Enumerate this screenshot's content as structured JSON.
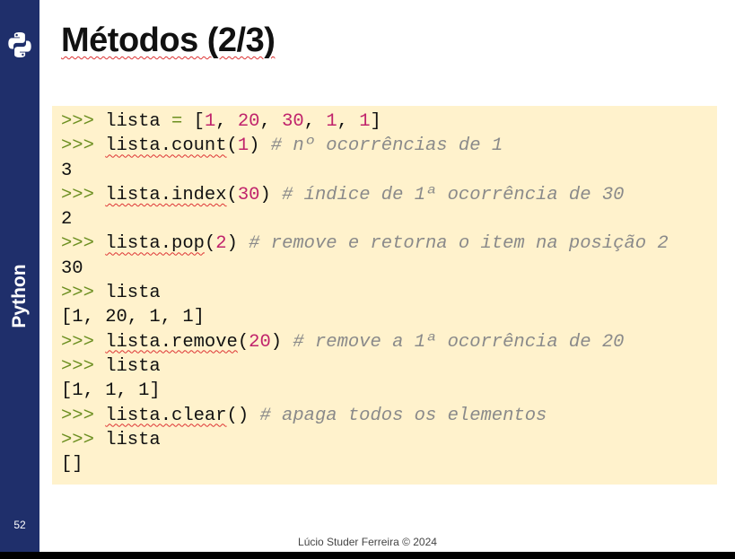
{
  "sidebar": {
    "label": "Python",
    "page_number": "52",
    "logo_icon": "python-logo-icon",
    "color": "#1f2f6b"
  },
  "slide": {
    "title": "Métodos (2/3)",
    "footer": "Lúcio Studer Ferreira © 2024"
  },
  "code": {
    "prompt": ">>>",
    "lines": [
      {
        "t": "in",
        "tokens": [
          {
            "k": "p",
            "v": ">>>"
          },
          {
            "k": "x",
            "v": " lista "
          },
          {
            "k": "e",
            "v": "="
          },
          {
            "k": "x",
            "v": " ["
          },
          {
            "k": "n",
            "v": "1"
          },
          {
            "k": "x",
            "v": ", "
          },
          {
            "k": "n",
            "v": "20"
          },
          {
            "k": "x",
            "v": ", "
          },
          {
            "k": "n",
            "v": "30"
          },
          {
            "k": "x",
            "v": ", "
          },
          {
            "k": "n",
            "v": "1"
          },
          {
            "k": "x",
            "v": ", "
          },
          {
            "k": "n",
            "v": "1"
          },
          {
            "k": "x",
            "v": "]"
          }
        ]
      },
      {
        "t": "in",
        "tokens": [
          {
            "k": "p",
            "v": ">>>"
          },
          {
            "k": "x",
            "v": " "
          },
          {
            "k": "w",
            "v": "lista.count"
          },
          {
            "k": "x",
            "v": "("
          },
          {
            "k": "n",
            "v": "1"
          },
          {
            "k": "x",
            "v": ") "
          },
          {
            "k": "c",
            "v": "# nº ocorrências de 1"
          }
        ]
      },
      {
        "t": "out",
        "tokens": [
          {
            "k": "x",
            "v": "3"
          }
        ]
      },
      {
        "t": "in",
        "tokens": [
          {
            "k": "p",
            "v": ">>>"
          },
          {
            "k": "x",
            "v": " "
          },
          {
            "k": "w",
            "v": "lista.index"
          },
          {
            "k": "x",
            "v": "("
          },
          {
            "k": "n",
            "v": "30"
          },
          {
            "k": "x",
            "v": ") "
          },
          {
            "k": "c",
            "v": "# índice de 1ª ocorrência de 30"
          }
        ]
      },
      {
        "t": "out",
        "tokens": [
          {
            "k": "x",
            "v": "2"
          }
        ]
      },
      {
        "t": "in",
        "tokens": [
          {
            "k": "p",
            "v": ">>>"
          },
          {
            "k": "x",
            "v": " "
          },
          {
            "k": "w",
            "v": "lista.pop"
          },
          {
            "k": "x",
            "v": "("
          },
          {
            "k": "n",
            "v": "2"
          },
          {
            "k": "x",
            "v": ") "
          },
          {
            "k": "c",
            "v": "# remove e retorna o item na posição 2"
          }
        ]
      },
      {
        "t": "out",
        "tokens": [
          {
            "k": "x",
            "v": "30"
          }
        ]
      },
      {
        "t": "in",
        "tokens": [
          {
            "k": "p",
            "v": ">>>"
          },
          {
            "k": "x",
            "v": " lista"
          }
        ]
      },
      {
        "t": "out",
        "tokens": [
          {
            "k": "x",
            "v": "[1, 20, 1, 1]"
          }
        ]
      },
      {
        "t": "in",
        "tokens": [
          {
            "k": "p",
            "v": ">>>"
          },
          {
            "k": "x",
            "v": " "
          },
          {
            "k": "w",
            "v": "lista.remove"
          },
          {
            "k": "x",
            "v": "("
          },
          {
            "k": "n",
            "v": "20"
          },
          {
            "k": "x",
            "v": ") "
          },
          {
            "k": "c",
            "v": "# remove a 1ª ocorrência de 20"
          }
        ]
      },
      {
        "t": "in",
        "tokens": [
          {
            "k": "p",
            "v": ">>>"
          },
          {
            "k": "x",
            "v": " lista"
          }
        ]
      },
      {
        "t": "out",
        "tokens": [
          {
            "k": "x",
            "v": "[1, 1, 1]"
          }
        ]
      },
      {
        "t": "in",
        "tokens": [
          {
            "k": "p",
            "v": ">>>"
          },
          {
            "k": "x",
            "v": " "
          },
          {
            "k": "w",
            "v": "lista.clear"
          },
          {
            "k": "x",
            "v": "() "
          },
          {
            "k": "c",
            "v": "# apaga todos os elementos"
          }
        ]
      },
      {
        "t": "in",
        "tokens": [
          {
            "k": "p",
            "v": ">>>"
          },
          {
            "k": "x",
            "v": " lista"
          }
        ]
      },
      {
        "t": "out",
        "tokens": [
          {
            "k": "x",
            "v": "[]"
          }
        ]
      }
    ]
  },
  "colors": {
    "code_background": "#fff2cc",
    "prompt": "#6b8e1f",
    "number": "#c0246c",
    "comment": "#8a8a8a"
  }
}
